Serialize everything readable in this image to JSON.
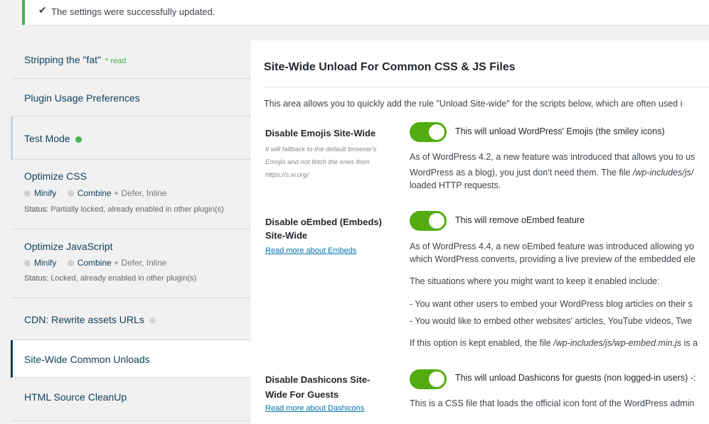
{
  "notice": {
    "check_icon": "✔",
    "message": "The settings were successfully updated."
  },
  "sidebar": {
    "stripping": {
      "title": "Stripping the \"fat\"",
      "read": "* read"
    },
    "plugin_usage": {
      "title": "Plugin Usage Preferences"
    },
    "test_mode": {
      "title": "Test Mode"
    },
    "optimize_css": {
      "title": "Optimize CSS",
      "minify": "Minify",
      "combine": "Combine",
      "extra": "+ Defer, Inline",
      "status_label": "Status:",
      "status": "Partially locked, already enabled in other plugin(s)"
    },
    "optimize_js": {
      "title": "Optimize JavaScript",
      "minify": "Minify",
      "combine": "Combine",
      "extra": "+ Defer, Inline",
      "status_label": "Status:",
      "status": "Locked, already enabled in other plugin(s)"
    },
    "cdn": {
      "title": "CDN: Rewrite assets URLs"
    },
    "site_wide": {
      "title": "Site-Wide Common Unloads"
    },
    "html_cleanup": {
      "title": "HTML Source CleanUp"
    }
  },
  "main": {
    "heading": "Site-Wide Unload For Common CSS & JS Files",
    "intro": "This area allows you to quickly add the rule \"Unload Site-wide\" for the scripts below, which are often used i",
    "emojis": {
      "label": "Disable Emojis Site-Wide",
      "sub1": "It will fallback to the default browser's",
      "sub2": "Emojis and not fetch the ones from",
      "sub3": "https://s.w.org/",
      "toggle_label": "This will unload WordPress' Emojis (the smiley icons)",
      "desc1": "As of WordPress 4.2, a new feature was introduced that allows you to us",
      "desc2a": "WordPress as a blog), you just don't need them. The file ",
      "desc2b": "/wp-includes/js/",
      "desc3": "loaded HTTP requests."
    },
    "oembed": {
      "label1": "Disable oEmbed (Embeds)",
      "label2": "Site-Wide",
      "link": "Read more about Embeds",
      "toggle_label": "This will remove oEmbed feature",
      "desc1": "As of WordPress 4.4, a new oEmbed feature was introduced allowing yo",
      "desc2": "which WordPress converts, providing a live preview of the embedded ele",
      "desc3": "The situations where you might want to keep it enabled include:",
      "desc4": "- You want other users to embed your WordPress blog articles on their s",
      "desc5": "- You would like to embed other websites' articles, YouTube videos, Twe",
      "desc6a": "If this option is kept enabled, the file ",
      "desc6b": "/wp-includes/js/wp-embed.min.js",
      "desc6c": " is a"
    },
    "dashicons": {
      "label1": "Disable Dashicons Site-",
      "label2": "Wide For Guests",
      "link": "Read more about Dashicons",
      "toggle_label": "This will unload Dashicons for guests (non logged-in users) -:",
      "desc1": "This is a CSS file that loads the official icon font of the WordPress admin"
    }
  },
  "colors": {
    "accent": "#0e3f5e",
    "toggle_on": "#52ac10",
    "success": "#46b450"
  }
}
